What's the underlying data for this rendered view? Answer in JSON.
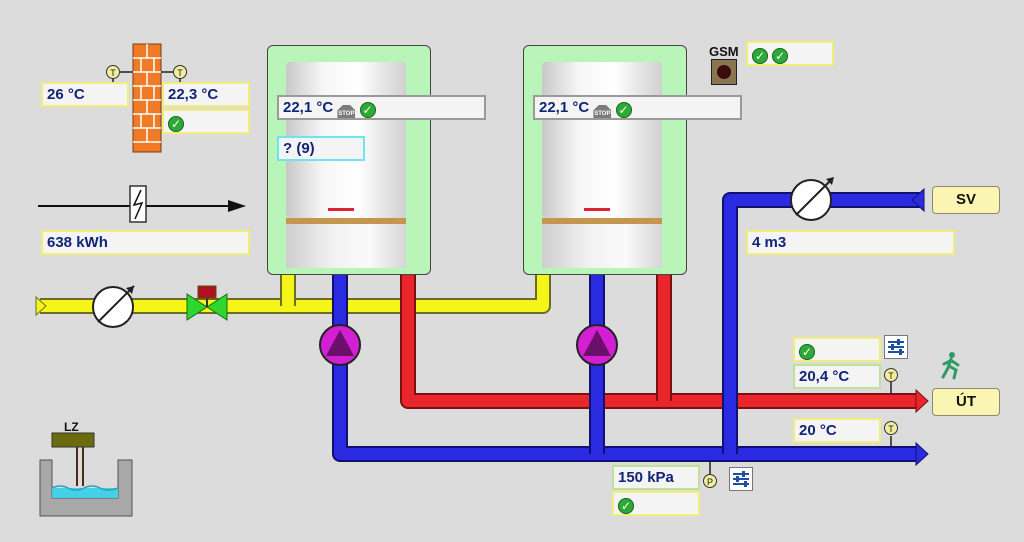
{
  "outdoor": {
    "temp_outside": "26 °C",
    "temp_inside": "22,3 °C",
    "status": "✓"
  },
  "energy": {
    "consumption": "638 kWh"
  },
  "boiler1": {
    "temp": "22,1 °C",
    "stop_label": "STOP",
    "status": "✓",
    "error": "? (9)"
  },
  "boiler2": {
    "temp": "22,1 °C",
    "stop_label": "STOP",
    "status": "✓"
  },
  "gsm": {
    "label": "GSM",
    "status1": "✓",
    "status2": "✓"
  },
  "cold_water": {
    "tag": "SV",
    "volume": "4 m3"
  },
  "heating": {
    "tag": "ÚT",
    "status": "✓",
    "supply_temp": "20,4 °C",
    "return_temp": "20 °C"
  },
  "pressure": {
    "value": "150 kPa",
    "status": "✓"
  },
  "sump": {
    "label": "LZ"
  },
  "sensor_letters": {
    "temp": "T",
    "pressure": "P"
  },
  "colors": {
    "gas": "#f5f51a",
    "hot": "#e8262b",
    "cold": "#2a2ae0",
    "panel": "#b9f5b9",
    "pump": "#d21fd2"
  }
}
